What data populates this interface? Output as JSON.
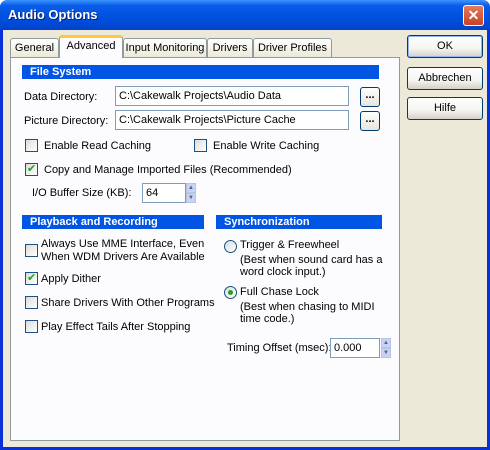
{
  "window": {
    "title": "Audio Options",
    "close_label": "✕"
  },
  "tabs": [
    {
      "label": "General"
    },
    {
      "label": "Advanced"
    },
    {
      "label": "Input Monitoring"
    },
    {
      "label": "Drivers"
    },
    {
      "label": "Driver Profiles"
    }
  ],
  "active_tab": "Advanced",
  "file_system": {
    "header": "File System",
    "data_dir_label": "Data Directory:",
    "data_dir_value": "C:\\Cakewalk Projects\\Audio Data",
    "picture_dir_label": "Picture Directory:",
    "picture_dir_value": "C:\\Cakewalk Projects\\Picture Cache",
    "browse_label": "...",
    "enable_read_caching": {
      "label": "Enable Read Caching",
      "checked": false
    },
    "enable_write_caching": {
      "label": "Enable Write Caching",
      "checked": false
    },
    "copy_manage": {
      "label": "Copy and Manage Imported Files (Recommended)",
      "checked": true
    },
    "io_buffer_label": "I/O Buffer Size (KB):",
    "io_buffer_value": "64"
  },
  "playback": {
    "header": "Playback and Recording",
    "mme": {
      "line1": "Always Use MME Interface, Even",
      "line2": "When WDM Drivers Are Available",
      "checked": false
    },
    "apply_dither": {
      "label": "Apply Dither",
      "checked": true
    },
    "share_drivers": {
      "label": "Share Drivers With Other Programs",
      "checked": false
    },
    "effect_tails": {
      "label": "Play Effect Tails After Stopping",
      "checked": false
    }
  },
  "sync": {
    "header": "Synchronization",
    "trigger": {
      "label": "Trigger & Freewheel",
      "desc1": "(Best when sound card has a",
      "desc2": "word clock input.)",
      "selected": false
    },
    "full_chase": {
      "label": "Full Chase Lock",
      "desc1": "(Best when chasing to MIDI",
      "desc2": "time code.)",
      "selected": true
    },
    "timing_offset_label": "Timing Offset (msec):",
    "timing_offset_value": "0.000"
  },
  "buttons": {
    "ok": "OK",
    "cancel": "Abbrechen",
    "help": "Hilfe"
  },
  "colors": {
    "title_bar": "#0053e1",
    "section_header": "#0055e5",
    "dialog_bg": "#ece9d8",
    "check": "#21a121"
  }
}
